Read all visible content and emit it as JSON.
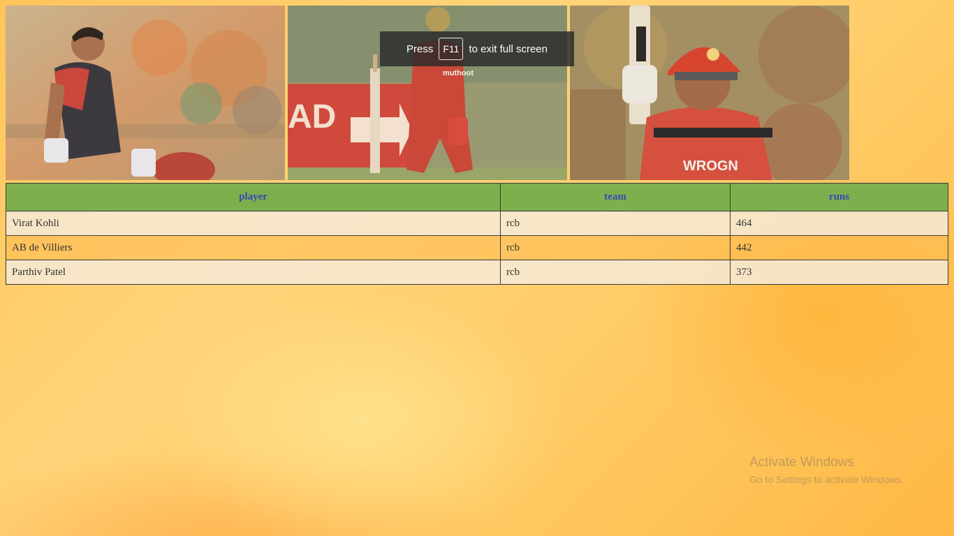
{
  "photos": [
    {
      "alt_icon": "player-celebration-photo"
    },
    {
      "alt_icon": "player-kneeling-photo"
    },
    {
      "alt_icon": "player-raising-bat-photo"
    }
  ],
  "fullscreen_hint": {
    "prefix": "Press",
    "key": "F11",
    "suffix": "to exit full screen"
  },
  "table": {
    "headers": [
      "player",
      "team",
      "runs"
    ],
    "rows": [
      [
        "Virat Kohli",
        "rcb",
        "464"
      ],
      [
        "AB de Villiers",
        "rcb",
        "442"
      ],
      [
        "Parthiv Patel",
        "rcb",
        "373"
      ]
    ]
  },
  "watermark": {
    "title": "Activate Windows",
    "subtitle": "Go to Settings to activate Windows."
  },
  "colors": {
    "header_bg": "#7db04c",
    "header_text": "#3b46b8",
    "team_red": "#d8453a"
  }
}
